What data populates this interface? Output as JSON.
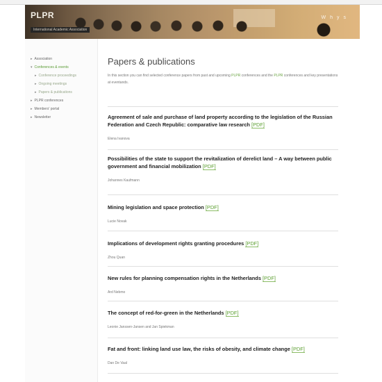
{
  "site": {
    "logo": "PLPR",
    "tagline": "International Academic Association",
    "topnav": [
      "W",
      "h",
      "y",
      "s"
    ]
  },
  "sidebar": {
    "items": [
      {
        "label": "Association",
        "level": 1,
        "active": false
      },
      {
        "label": "Conferences & events",
        "level": 1,
        "active": true
      },
      {
        "label": "Conference proceedings",
        "level": 2,
        "active": false
      },
      {
        "label": "Ongoing meetings",
        "level": 2,
        "active": false
      },
      {
        "label": "Papers & publications",
        "level": 2,
        "active": false
      },
      {
        "label": "PLPR conferences",
        "level": 1,
        "active": false
      },
      {
        "label": "Members' portal",
        "level": 1,
        "active": false
      },
      {
        "label": "Newsletter",
        "level": 1,
        "active": false
      }
    ]
  },
  "main": {
    "title": "Papers & publications",
    "intro_a": "In this section you can find selected conference papers from past and upcoming ",
    "intro_highlight_1": "PLPR",
    "intro_b": " conferences and the ",
    "intro_highlight_2": "PLPR",
    "intro_c": " conferences and key presentations at eventands.",
    "pdf_label": "[PDF]"
  },
  "publications": [
    {
      "title": "Agreement of sale and purchase of land property according to the legislation of the Russian Federation and Czech Republic: comparative law research",
      "author": "Elena Ivanova"
    },
    {
      "title": "Possibilities of the state to support the revitalization of derelict land – A way between public government and financial mobilization",
      "author": "Johannes Kaufmann"
    },
    {
      "title": "Mining legislation and space protection",
      "author": "Lucie Novak"
    },
    {
      "title": "Implications of development rights granting procedures",
      "author": "Zhou Quan"
    },
    {
      "title": "New rules for planning compensation rights in the Netherlands",
      "author": "Ard Nebmo"
    },
    {
      "title": "The concept of red-for-green in the Netherlands",
      "author": "Leonie Janssen-Jansen and Jan Spiekman"
    },
    {
      "title": "Fat and front: linking land use law, the risks of obesity, and climate change",
      "author": "Dan De Vaal"
    }
  ]
}
